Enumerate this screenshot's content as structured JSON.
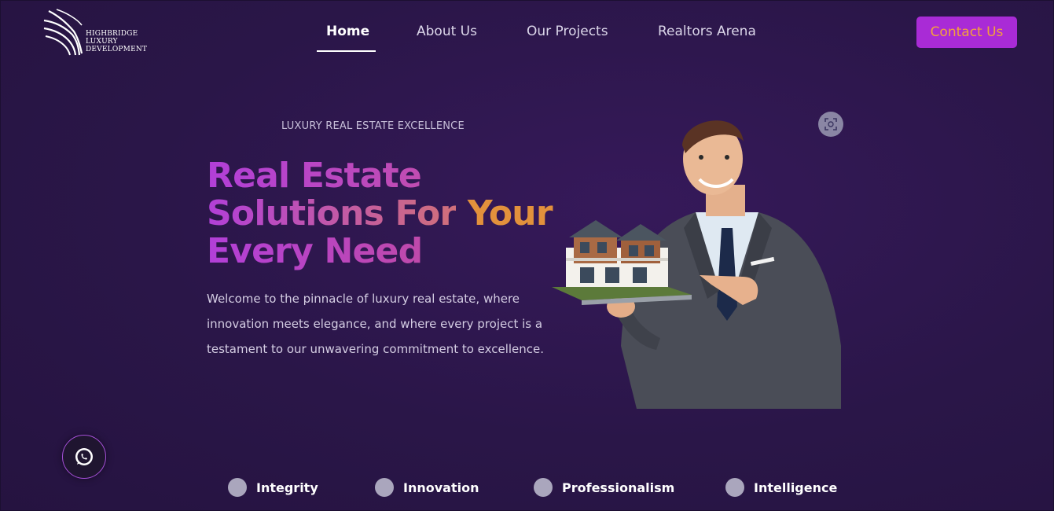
{
  "brand": {
    "logo_lines": [
      "Highbridge",
      "Luxury",
      "Development"
    ]
  },
  "nav": {
    "items": [
      {
        "label": "Home",
        "active": true
      },
      {
        "label": "About Us",
        "active": false
      },
      {
        "label": "Our Projects",
        "active": false
      },
      {
        "label": "Realtors Arena",
        "active": false
      }
    ],
    "contact_label": "Contact Us"
  },
  "hero": {
    "eyebrow": "LUXURY REAL ESTATE EXCELLENCE",
    "headline_line1": "Real Estate",
    "headline_line2_a": "Solutions For",
    "headline_line2_b": "Your",
    "headline_line3": "Every Need",
    "description": "Welcome to the pinnacle of luxury real estate, where innovation meets elegance, and where every project is a testament to our unwavering commitment to excellence."
  },
  "values": [
    {
      "label": "Integrity"
    },
    {
      "label": "Innovation"
    },
    {
      "label": "Professionalism"
    },
    {
      "label": "Intelligence"
    }
  ],
  "icons": {
    "whatsapp": "whatsapp-icon",
    "scan": "scan-icon"
  },
  "colors": {
    "background": "#2a1648",
    "accent": "#a92bd6",
    "accent_text": "#f3a13c",
    "headline_purple": "#b33ed6",
    "headline_pink": "#c7508f",
    "headline_orange": "#e2913c"
  }
}
